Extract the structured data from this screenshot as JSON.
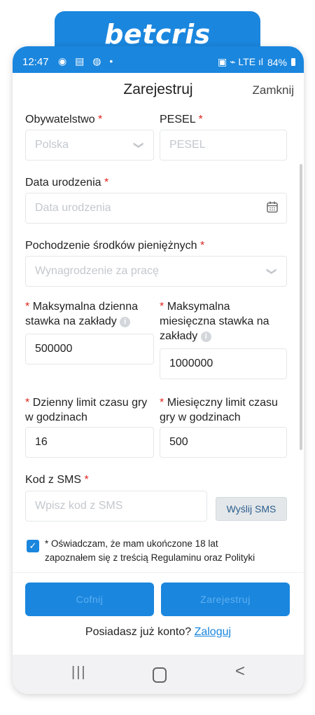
{
  "brand": {
    "logo_text": "betcris"
  },
  "statusbar": {
    "time": "12:47",
    "left_icons": "◉ ▤ ◍ •",
    "right_icons": "▣ ⌁ LTE ıl",
    "battery": "84%"
  },
  "header": {
    "title": "Zarejestruj",
    "close_label": "Zamknij"
  },
  "form": {
    "citizenship": {
      "label": "Obywatelstwo",
      "required_mark": "*",
      "value": "Polska"
    },
    "pesel": {
      "label": "PESEL",
      "required_mark": "*",
      "placeholder": "PESEL"
    },
    "birthdate": {
      "label": "Data urodzenia",
      "required_mark": "*",
      "placeholder": "Data urodzenia"
    },
    "funds_origin": {
      "label": "Pochodzenie środków pieniężnych",
      "required_mark": "*",
      "placeholder": "Wynagrodzenie za pracę"
    },
    "daily_stake": {
      "required_mark": "*",
      "label_line1": "Maksymalna dzienna",
      "label_line2": "stawka na zakłady",
      "value": "500000"
    },
    "monthly_stake": {
      "required_mark": "*",
      "label_line1": "Maksymalna",
      "label_line2": "miesięczna stawka na",
      "label_line3": "zakłady",
      "value": "1000000"
    },
    "daily_time": {
      "required_mark": "*",
      "label_line1": "Dzienny limit czasu gry",
      "label_line2": "w godzinach",
      "value": "16"
    },
    "monthly_time": {
      "required_mark": "*",
      "label_line1": "Miesięczny limit czasu",
      "label_line2": "gry w godzinach",
      "value": "500"
    },
    "sms_code": {
      "label": "Kod z SMS",
      "required_mark": "*",
      "placeholder": "Wpisz kod z SMS",
      "send_button": "Wyślij SMS"
    },
    "consent": {
      "checked": true,
      "line1": "* Oświadczam, że mam ukończone 18 lat",
      "line2": "zapoznałem się z treścią Regulaminu oraz Polityki"
    }
  },
  "footer": {
    "back_button": "Cofnij",
    "register_button": "Zarejestruj",
    "login_prompt": "Posiadasz już konto?",
    "login_link": "Zaloguj"
  },
  "navbar": {
    "recent": "|||",
    "back": "<"
  },
  "colors": {
    "accent": "#1a86de",
    "required": "#e0261f"
  }
}
